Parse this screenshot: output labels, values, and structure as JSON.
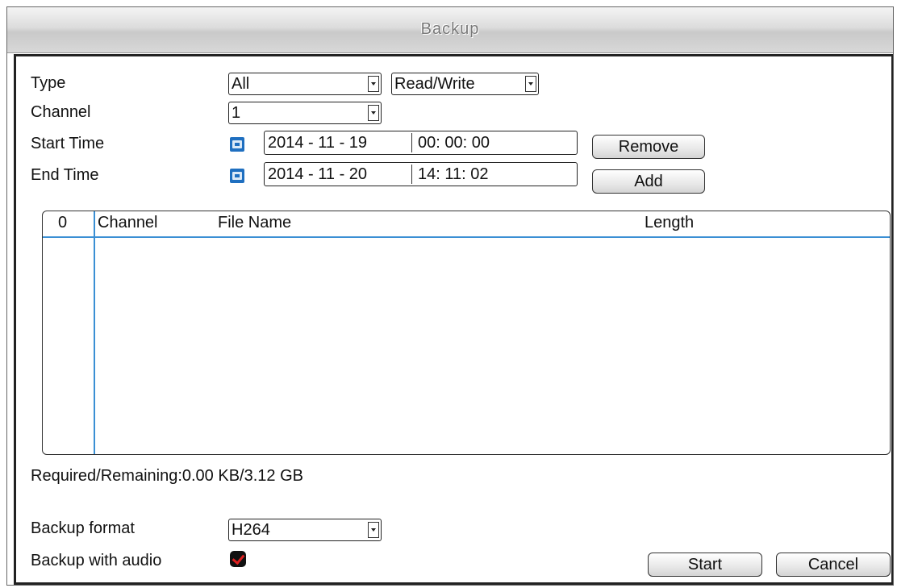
{
  "window": {
    "title": "Backup"
  },
  "form": {
    "type_label": "Type",
    "type_value": "All",
    "mode_value": "Read/Write",
    "channel_label": "Channel",
    "channel_value": "1",
    "start_label": "Start Time",
    "start_date": "2014 - 11 - 19",
    "start_time": "00: 00: 00",
    "end_label": "End Time",
    "end_date": "2014 - 11 - 20",
    "end_time": "14: 11: 02",
    "remove_button": "Remove",
    "add_button": "Add"
  },
  "file_list": {
    "columns": [
      "0",
      "Channel",
      "File Name",
      "Length"
    ],
    "rows": []
  },
  "status": {
    "required_remaining": "Required/Remaining:0.00 KB/3.12 GB"
  },
  "footer": {
    "format_label": "Backup format",
    "format_value": "H264",
    "audio_label": "Backup with audio",
    "audio_checked": true,
    "start_button": "Start",
    "cancel_button": "Cancel"
  },
  "icons": {
    "date_picker": "calendar-icon",
    "dropdown": "chevron-down-icon",
    "check": "check-icon"
  },
  "colors": {
    "accent_line": "#3a8fd4",
    "calendar_icon": "#1f6fc0",
    "check_mark": "#e02020"
  }
}
